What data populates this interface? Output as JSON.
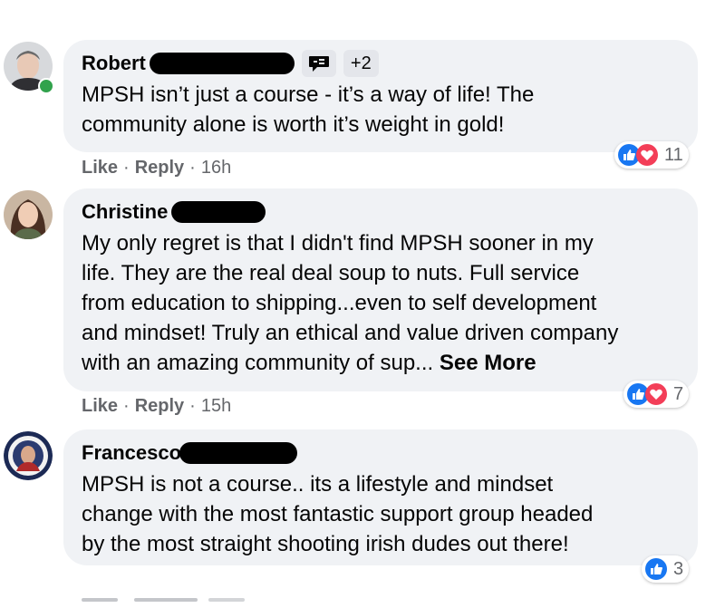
{
  "colors": {
    "bubble_bg": "#f0f2f5",
    "meta_text": "#65676b",
    "like_blue": "#1877f2",
    "love_red": "#f33e58",
    "online_green": "#31a24c"
  },
  "comments": [
    {
      "author": "Robert",
      "badge_icon": "chat-bubble-icon",
      "badge_label": "+2",
      "text": "MPSH isn’t just a course - it’s a way of life! The\ncommunity alone is worth it’s weight in gold!",
      "like_label": "Like",
      "reply_label": "Reply",
      "time": "16h",
      "reaction_count": "11",
      "reactions": [
        "like",
        "love"
      ],
      "online": true
    },
    {
      "author": "Christine",
      "text": "My only regret is that I didn't find MPSH sooner in my\nlife. They are the real deal soup to nuts. Full service\nfrom education to shipping...even to self development\nand mindset! Truly an ethical and value driven company\nwith an amazing community of sup... ",
      "see_more": "See More",
      "like_label": "Like",
      "reply_label": "Reply",
      "time": "15h",
      "reaction_count": "7",
      "reactions": [
        "like",
        "love"
      ]
    },
    {
      "author": "Francesco",
      "text": "MPSH is not a course.. its a lifestyle and mindset\nchange with the most fantastic support group headed\nby the most straight shooting irish dudes out there!",
      "reaction_count": "3",
      "reactions": [
        "like"
      ]
    }
  ],
  "separator": "·"
}
